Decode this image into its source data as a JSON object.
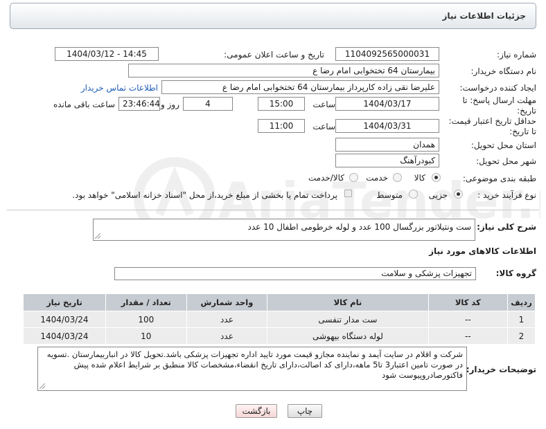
{
  "header": {
    "title": "جزئیات اطلاعات نیاز"
  },
  "form": {
    "need_number_label": "شماره نیاز:",
    "need_number": "1104092565000031",
    "announce_label": "تاریخ و ساعت اعلان عمومی:",
    "announce_value": "1404/03/12 - 14:45",
    "buyer_org_label": "نام دستگاه خریدار:",
    "buyer_org": "بیمارستان  64 تختخوابی امام رضا   ع",
    "creator_label": "ایجاد کننده درخواست:",
    "creator": "علیرضا نقی زاده کارپرداز بیمارستان  64 تختخوابی امام رضا   ع",
    "contact_link": "اطلاعات تماس خریدار",
    "deadline_label_1": "مهلت ارسال پاسخ: تا",
    "deadline_label_2": "تاریخ:",
    "deadline_date": "1404/03/17",
    "time_label": "ساعت",
    "deadline_time": "15:00",
    "days_value": "4",
    "days_label": "روز و",
    "remaining_time": "23:46:44",
    "remaining_label": "ساعت باقی مانده",
    "validity_label_1": "حداقل تاریخ اعتبار قیمت:",
    "validity_label_2": "تا تاریخ:",
    "validity_date": "1404/03/31",
    "validity_time_label": "ساعت",
    "validity_time": "11:00",
    "province_label": "استان محل تحویل:",
    "province": "همدان",
    "city_label": "شهر محل تحویل:",
    "city": "کبودرآهنگ",
    "category_label": "طبقه بندی موضوعی:",
    "category_options": [
      "کالا",
      "خدمت",
      "کالا/خدمت"
    ],
    "process_label": "نوع فرآیند خرید :",
    "process_options": [
      "جزیی",
      "متوسط"
    ],
    "payment_note": "پرداخت تمام یا بخشی از مبلغ خرید،از محل \"اسناد خزانه اسلامی\" خواهد بود."
  },
  "description": {
    "label": "شرح کلی نیاز:",
    "text": "ست ونتیلاتور بزرگسال 100 عدد و لوله خرطومی اطفال 10 عدد"
  },
  "goods": {
    "section_title": "اطلاعات کالاهای مورد نیاز",
    "group_label": "گروه کالا:",
    "group_value": "تجهیزات پزشکی و سلامت",
    "columns": [
      "ردیف",
      "کد کالا",
      "نام کالا",
      "واحد شمارش",
      "تعداد / مقدار",
      "تاریخ نیاز"
    ],
    "rows": [
      [
        "1",
        "--",
        "ست مدار تنفسی",
        "عدد",
        "100",
        "1404/03/24"
      ],
      [
        "2",
        "--",
        "لوله دستگاه بیهوشی",
        "عدد",
        "10",
        "1404/03/24"
      ]
    ]
  },
  "buyer_notes": {
    "label": "توضیحات خریدار:",
    "text": "شرکت و اقلام در سایت آیمد و نماینده مجازو قیمت مورد تایید اداره تجهیزات پزشکی باشد.تحویل کالا در انباربیمارستان .تسویه در صورت تامین اعتبار3 تا5 ماهه،دارای کد اصالت،دارای تاریخ انقضاء،مشخصات کالا منطبق بر شرایط اعلام شده پیش فاکتورصادروپیوست شود"
  },
  "buttons": {
    "print": "چاپ",
    "back": "بازگشت"
  },
  "watermark": {
    "text": "AriaTender.net"
  },
  "colors": {
    "link": "#1f5db8",
    "table_header": "#c7ccd2",
    "table_row": "#ececec",
    "back_button": "#fde7e7"
  }
}
